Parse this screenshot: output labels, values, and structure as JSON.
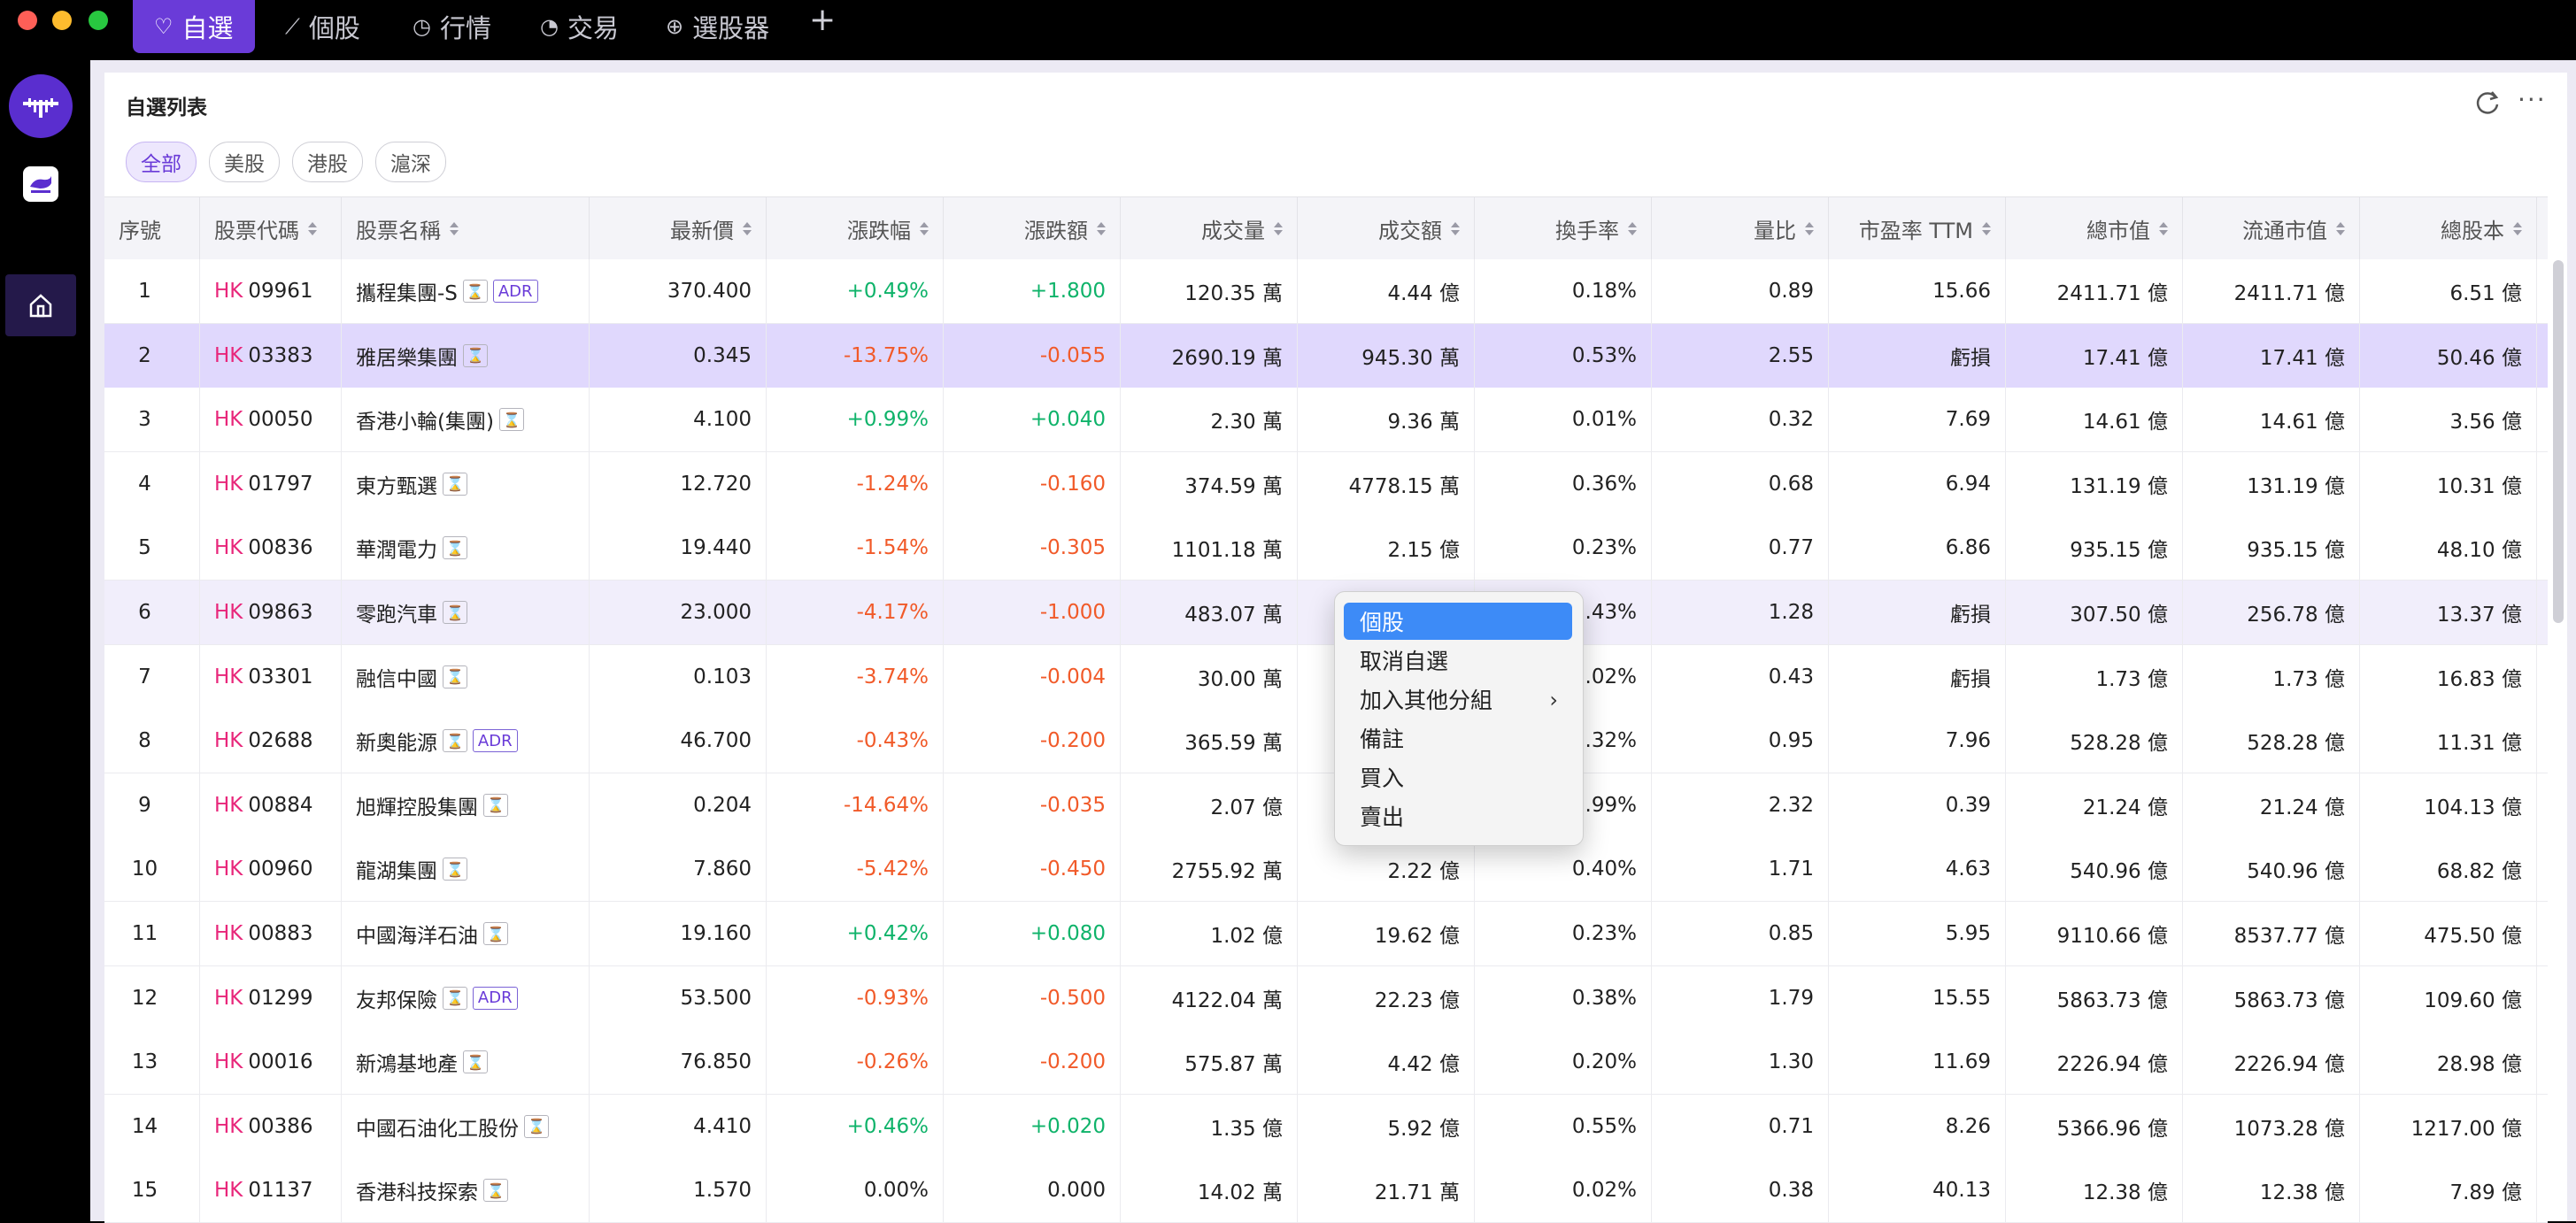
{
  "nav": {
    "tabs": [
      {
        "label": "自選",
        "icon": "heart-icon"
      },
      {
        "label": "個股",
        "icon": "chart-line-icon"
      },
      {
        "label": "行情",
        "icon": "clock-icon"
      },
      {
        "label": "交易",
        "icon": "pie-icon"
      },
      {
        "label": "選股器",
        "icon": "target-icon"
      }
    ],
    "add_label": "+"
  },
  "sidebar": {
    "logo_icon": "whale-logo-icon",
    "app_icon": "whale-app-icon",
    "home_icon": "home-icon"
  },
  "panel": {
    "title": "自選列表",
    "refresh_icon": "refresh-icon",
    "more_label": "···",
    "filters": [
      "全部",
      "美股",
      "港股",
      "滬深"
    ],
    "active_filter": "全部"
  },
  "table": {
    "columns": [
      "序號",
      "股票代碼",
      "股票名稱",
      "最新價",
      "漲跌幅",
      "漲跌額",
      "成交量",
      "成交額",
      "換手率",
      "量比",
      "市盈率 TTM",
      "總市值",
      "流通市值",
      "總股本"
    ],
    "market_prefix": "HK",
    "rows": [
      {
        "no": "1",
        "code": "09961",
        "name": "攜程集團-S",
        "adr": true,
        "price": "370.400",
        "pct": "+0.49%",
        "chg": "+1.800",
        "dir": "up",
        "vol": "120.35 萬",
        "amt": "4.44 億",
        "turn": "0.18%",
        "ratio": "0.89",
        "pe": "15.66",
        "cap": "2411.71 億",
        "float": "2411.71 億",
        "shares": "6.51 億"
      },
      {
        "no": "2",
        "code": "03383",
        "name": "雅居樂集團",
        "adr": false,
        "price": "0.345",
        "pct": "-13.75%",
        "chg": "-0.055",
        "dir": "down",
        "vol": "2690.19 萬",
        "amt": "945.30 萬",
        "turn": "0.53%",
        "ratio": "2.55",
        "pe": "虧損",
        "cap": "17.41 億",
        "float": "17.41 億",
        "shares": "50.46 億"
      },
      {
        "no": "3",
        "code": "00050",
        "name": "香港小輪(集團)",
        "adr": false,
        "price": "4.100",
        "pct": "+0.99%",
        "chg": "+0.040",
        "dir": "up",
        "vol": "2.30 萬",
        "amt": "9.36 萬",
        "turn": "0.01%",
        "ratio": "0.32",
        "pe": "7.69",
        "cap": "14.61 億",
        "float": "14.61 億",
        "shares": "3.56 億"
      },
      {
        "no": "4",
        "code": "01797",
        "name": "東方甄選",
        "adr": false,
        "price": "12.720",
        "pct": "-1.24%",
        "chg": "-0.160",
        "dir": "down",
        "vol": "374.59 萬",
        "amt": "4778.15 萬",
        "turn": "0.36%",
        "ratio": "0.68",
        "pe": "6.94",
        "cap": "131.19 億",
        "float": "131.19 億",
        "shares": "10.31 億"
      },
      {
        "no": "5",
        "code": "00836",
        "name": "華潤電力",
        "adr": false,
        "price": "19.440",
        "pct": "-1.54%",
        "chg": "-0.305",
        "dir": "down",
        "vol": "1101.18 萬",
        "amt": "2.15 億",
        "turn": "0.23%",
        "ratio": "0.77",
        "pe": "6.86",
        "cap": "935.15 億",
        "float": "935.15 億",
        "shares": "48.10 億"
      },
      {
        "no": "6",
        "code": "09863",
        "name": "零跑汽車",
        "adr": false,
        "price": "23.000",
        "pct": "-4.17%",
        "chg": "-1.000",
        "dir": "down",
        "vol": "483.07 萬",
        "amt": "",
        "turn": "0.43%",
        "ratio": "1.28",
        "pe": "虧損",
        "cap": "307.50 億",
        "float": "256.78 億",
        "shares": "13.37 億"
      },
      {
        "no": "7",
        "code": "03301",
        "name": "融信中國",
        "adr": false,
        "price": "0.103",
        "pct": "-3.74%",
        "chg": "-0.004",
        "dir": "down",
        "vol": "30.00 萬",
        "amt": "",
        "turn": "0.02%",
        "ratio": "0.43",
        "pe": "虧損",
        "cap": "1.73 億",
        "float": "1.73 億",
        "shares": "16.83 億"
      },
      {
        "no": "8",
        "code": "02688",
        "name": "新奧能源",
        "adr": true,
        "price": "46.700",
        "pct": "-0.43%",
        "chg": "-0.200",
        "dir": "down",
        "vol": "365.59 萬",
        "amt": "",
        "turn": "0.32%",
        "ratio": "0.95",
        "pe": "7.96",
        "cap": "528.28 億",
        "float": "528.28 億",
        "shares": "11.31 億"
      },
      {
        "no": "9",
        "code": "00884",
        "name": "旭輝控股集團",
        "adr": false,
        "price": "0.204",
        "pct": "-14.64%",
        "chg": "-0.035",
        "dir": "down",
        "vol": "2.07 億",
        "amt": "",
        "turn": "1.99%",
        "ratio": "2.32",
        "pe": "0.39",
        "cap": "21.24 億",
        "float": "21.24 億",
        "shares": "104.13 億"
      },
      {
        "no": "10",
        "code": "00960",
        "name": "龍湖集團",
        "adr": false,
        "price": "7.860",
        "pct": "-5.42%",
        "chg": "-0.450",
        "dir": "down",
        "vol": "2755.92 萬",
        "amt": "2.22 億",
        "turn": "0.40%",
        "ratio": "1.71",
        "pe": "4.63",
        "cap": "540.96 億",
        "float": "540.96 億",
        "shares": "68.82 億"
      },
      {
        "no": "11",
        "code": "00883",
        "name": "中國海洋石油",
        "adr": false,
        "price": "19.160",
        "pct": "+0.42%",
        "chg": "+0.080",
        "dir": "up",
        "vol": "1.02 億",
        "amt": "19.62 億",
        "turn": "0.23%",
        "ratio": "0.85",
        "pe": "5.95",
        "cap": "9110.66 億",
        "float": "8537.77 億",
        "shares": "475.50 億"
      },
      {
        "no": "12",
        "code": "01299",
        "name": "友邦保險",
        "adr": true,
        "price": "53.500",
        "pct": "-0.93%",
        "chg": "-0.500",
        "dir": "down",
        "vol": "4122.04 萬",
        "amt": "22.23 億",
        "turn": "0.38%",
        "ratio": "1.79",
        "pe": "15.55",
        "cap": "5863.73 億",
        "float": "5863.73 億",
        "shares": "109.60 億"
      },
      {
        "no": "13",
        "code": "00016",
        "name": "新鴻基地產",
        "adr": false,
        "price": "76.850",
        "pct": "-0.26%",
        "chg": "-0.200",
        "dir": "down",
        "vol": "575.87 萬",
        "amt": "4.42 億",
        "turn": "0.20%",
        "ratio": "1.30",
        "pe": "11.69",
        "cap": "2226.94 億",
        "float": "2226.94 億",
        "shares": "28.98 億"
      },
      {
        "no": "14",
        "code": "00386",
        "name": "中國石油化工股份",
        "adr": false,
        "price": "4.410",
        "pct": "+0.46%",
        "chg": "+0.020",
        "dir": "up",
        "vol": "1.35 億",
        "amt": "5.92 億",
        "turn": "0.55%",
        "ratio": "0.71",
        "pe": "8.26",
        "cap": "5366.96 億",
        "float": "1073.28 億",
        "shares": "1217.00 億"
      },
      {
        "no": "15",
        "code": "01137",
        "name": "香港科技探索",
        "adr": false,
        "price": "1.570",
        "pct": "0.00%",
        "chg": "0.000",
        "dir": "flat",
        "vol": "14.02 萬",
        "amt": "21.71 萬",
        "turn": "0.02%",
        "ratio": "0.38",
        "pe": "40.13",
        "cap": "12.38 億",
        "float": "12.38 億",
        "shares": "7.89 億"
      }
    ],
    "highlighted_row": "2",
    "hover_row": "6"
  },
  "context_menu": {
    "items": [
      "個股",
      "取消自選",
      "加入其他分組",
      "備註",
      "買入",
      "賣出"
    ],
    "selected": "個股",
    "submenu_item": "加入其他分組",
    "submenu_arrow": "›"
  },
  "colors": {
    "accent": "#6a3bd8",
    "up": "#0fb36a",
    "down": "#f15a29",
    "market_prefix": "#e8267a",
    "menu_selected": "#3d8bf7"
  }
}
